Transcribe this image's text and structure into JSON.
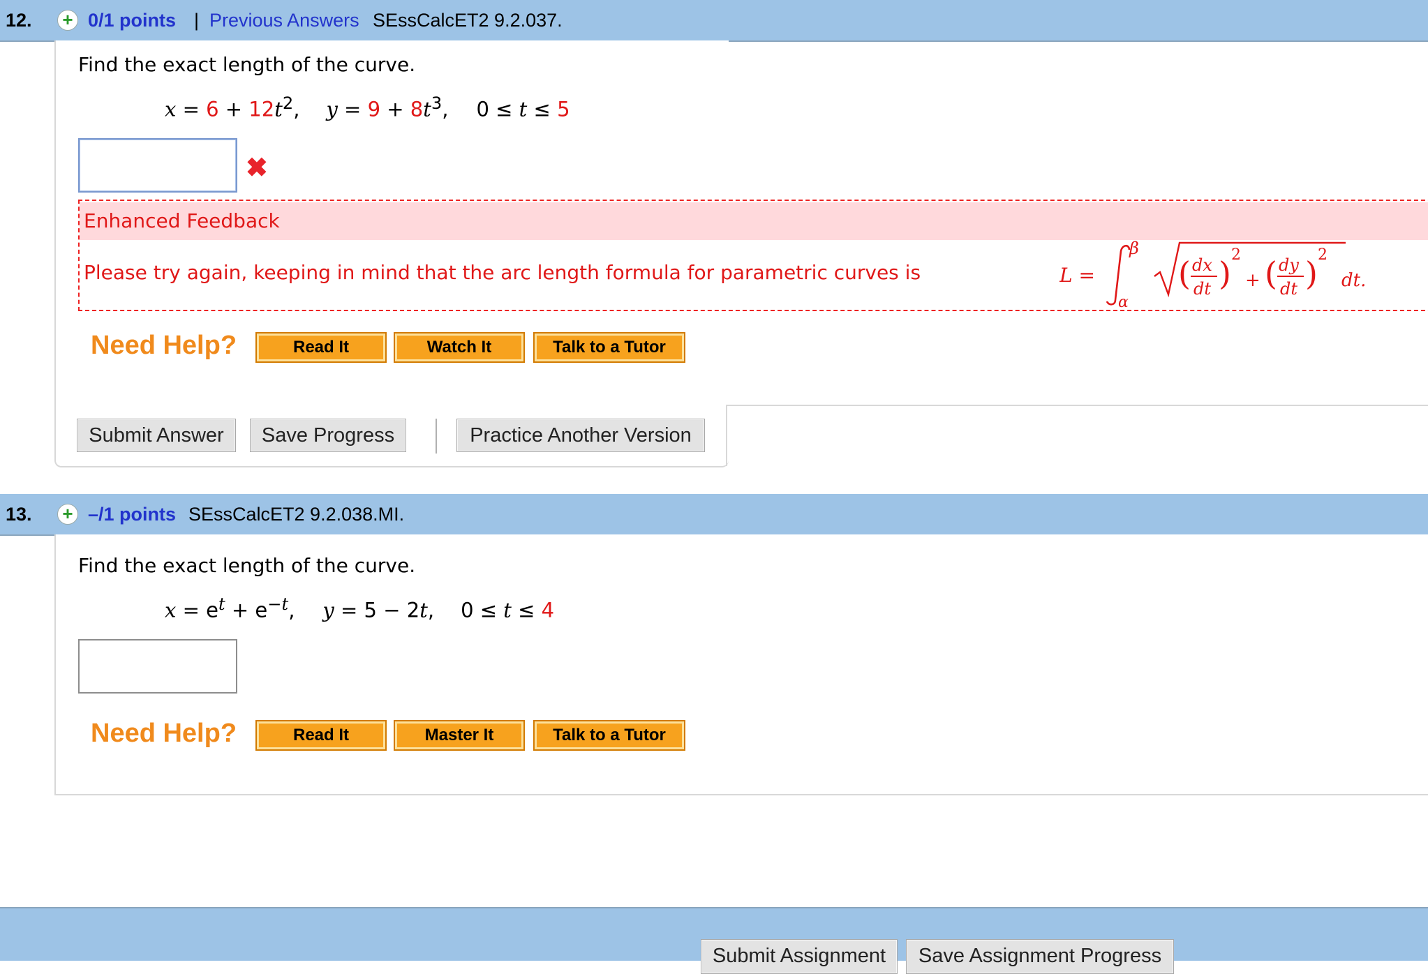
{
  "questions": [
    {
      "number": "12.",
      "points": "0/1 points",
      "separator": "|",
      "previous_answers": "Previous Answers",
      "code": "SEssCalcET2 9.2.037.",
      "prompt": "Find the exact length of the curve.",
      "equation": {
        "x_prefix": "x = ",
        "x_c1": "6",
        "x_plus": " + ",
        "x_c2": "12",
        "x_var": "t",
        "x_exp": "2",
        "comma1": ",",
        "y_prefix": "y = ",
        "y_c1": "9",
        "y_plus": " + ",
        "y_c2": "8",
        "y_var": "t",
        "y_exp": "3",
        "comma2": ",",
        "range_prefix": "0 ≤ ",
        "range_var": "t",
        "range_mid": " ≤ ",
        "range_max": "5"
      },
      "answer_value": "",
      "status": "incorrect",
      "feedback": {
        "title": "Enhanced Feedback",
        "text": "Please try again, keeping in mind that the arc length formula for parametric curves is",
        "formula": {
          "lhs": "L =",
          "upper": "β",
          "lower": "α",
          "dx": "dx",
          "dy": "dy",
          "dt": "dt",
          "exp": "2",
          "plus": "+",
          "tail": "dt."
        }
      },
      "help": {
        "label": "Need Help?",
        "buttons": [
          "Read It",
          "Watch It",
          "Talk to a Tutor"
        ]
      },
      "actions": {
        "submit": "Submit Answer",
        "save": "Save Progress",
        "practice": "Practice Another Version"
      }
    },
    {
      "number": "13.",
      "points": "–/1 points",
      "code": "SEssCalcET2 9.2.038.MI.",
      "prompt": "Find the exact length of the curve.",
      "equation": {
        "x_prefix": "x = ",
        "x_e1": "e",
        "x_exp1": "t",
        "x_plus": " + ",
        "x_e2": "e",
        "x_exp2": "−t",
        "comma1": ",",
        "y_prefix": "y = ",
        "y_body": "5 − 2",
        "y_var": "t",
        "comma2": ",",
        "range_prefix": "0 ≤ ",
        "range_var": "t",
        "range_mid": " ≤ ",
        "range_max": "4"
      },
      "answer_value": "",
      "help": {
        "label": "Need Help?",
        "buttons": [
          "Read It",
          "Master It",
          "Talk to a Tutor"
        ]
      }
    }
  ],
  "footer": {
    "submit_assignment": "Submit Assignment",
    "save_assignment": "Save Assignment Progress"
  },
  "colors": {
    "header_bar": "#9dc3e6",
    "points_link": "#2233cc",
    "error_red": "#e01818",
    "feedback_bg": "#ffd9dc",
    "help_orange": "#f08a1c",
    "help_button": "#f7a21e"
  }
}
